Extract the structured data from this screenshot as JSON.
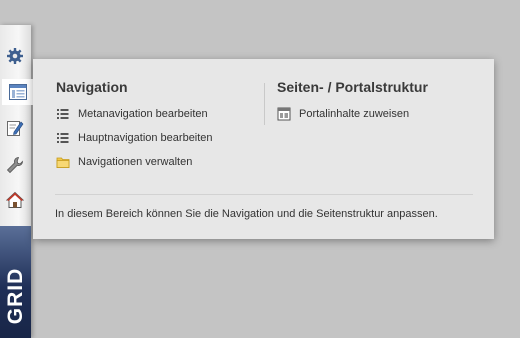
{
  "sidebar": {
    "buttons": [
      {
        "icon": "gear-icon"
      },
      {
        "icon": "layout-icon"
      },
      {
        "icon": "edit-icon"
      },
      {
        "icon": "wrench-icon"
      },
      {
        "icon": "home-icon"
      }
    ],
    "brand": "GRID"
  },
  "panel": {
    "navigation": {
      "title": "Navigation",
      "items": [
        {
          "label": "Metanavigation bearbeiten",
          "icon": "list-icon"
        },
        {
          "label": "Hauptnavigation bearbeiten",
          "icon": "list-icon"
        },
        {
          "label": "Navigationen verwalten",
          "icon": "folder-icon"
        }
      ]
    },
    "structure": {
      "title": "Seiten- / Portalstruktur",
      "items": [
        {
          "label": "Portalinhalte zuweisen",
          "icon": "portal-layout-icon"
        }
      ]
    },
    "info": "In diesem Bereich können Sie die Navigation und die Seitenstruktur anpassen."
  }
}
